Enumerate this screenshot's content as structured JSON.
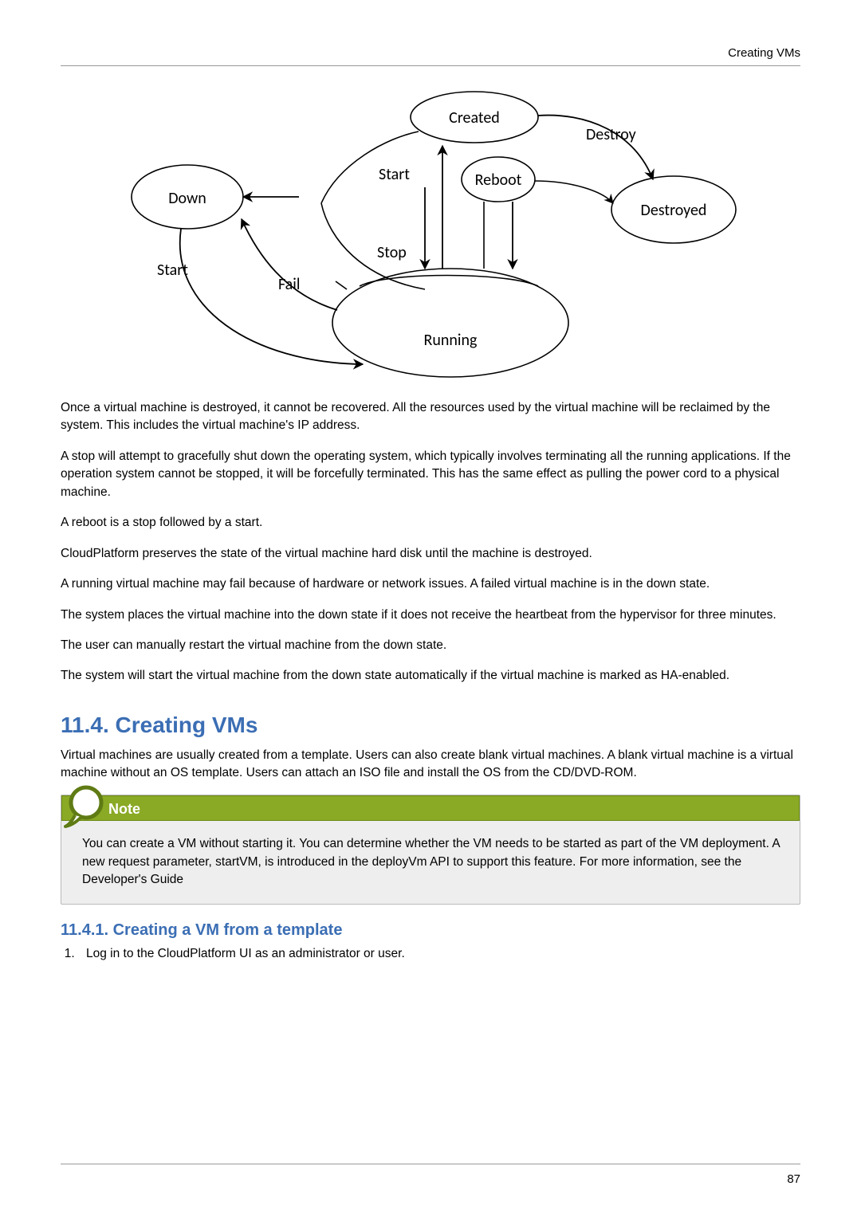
{
  "header": {
    "running_title": "Creating VMs"
  },
  "diagram": {
    "created": "Created",
    "start": "Start",
    "reboot": "Reboot",
    "destroy": "Destroy",
    "destroyed": "Destroyed",
    "down": "Down",
    "start2": "Start",
    "stop": "Stop",
    "fail": "Fail",
    "running": "Running"
  },
  "body": {
    "p1": "Once a virtual machine is destroyed, it cannot be recovered. All the resources used by the virtual machine will be reclaimed by the system. This includes the virtual machine's IP address.",
    "p2": "A stop will attempt to gracefully shut down the operating system, which typically involves terminating all the running applications. If the operation system cannot be stopped, it will be forcefully terminated. This has the same effect as pulling the power cord to a physical machine.",
    "p3": "A reboot is a stop followed by a start.",
    "p4": "CloudPlatform preserves the state of the virtual machine hard disk until the machine is destroyed.",
    "p5": "A running virtual machine may fail because of hardware or network issues. A failed virtual machine is in the down state.",
    "p6": "The system places the virtual machine into the down state if it does not receive the heartbeat from the hypervisor for three minutes.",
    "p7": "The user can manually restart the virtual machine from the down state.",
    "p8": "The system will start the virtual machine from the down state automatically if the virtual machine is marked as HA-enabled."
  },
  "section": {
    "title": "11.4. Creating VMs",
    "intro": "Virtual machines are usually created from a template. Users can also create blank virtual machines. A blank virtual machine is a virtual machine without an OS template. Users can attach an ISO file and install the OS from the CD/DVD-ROM."
  },
  "note": {
    "label": "Note",
    "body": "You can create a VM without starting it. You can determine whether the VM needs to be started as part of the VM deployment. A new request parameter, startVM, is introduced in the deployVm API to support this feature. For more information, see the Developer's Guide"
  },
  "subsection": {
    "title": "11.4.1. Creating a VM from a template",
    "step1": "Log in to the CloudPlatform UI as an administrator or user."
  },
  "footer": {
    "page": "87"
  }
}
